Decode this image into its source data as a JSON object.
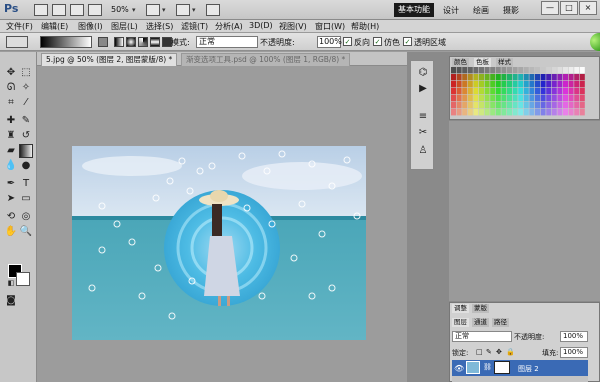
{
  "app": {
    "logo": "Ps"
  },
  "titlebar": {
    "zoom": "50%",
    "workspace_active": "基本功能",
    "workspace_links": [
      "设计",
      "绘画",
      "摄影"
    ],
    "window_buttons": [
      "—",
      "□",
      "×"
    ],
    "chevrons": [
      "▾",
      "▾",
      "▾"
    ]
  },
  "menu": [
    "文件(F)",
    "编辑(E)",
    "图像(I)",
    "图层(L)",
    "选择(S)",
    "滤镜(T)",
    "分析(A)",
    "3D(D)",
    "视图(V)",
    "窗口(W)",
    "帮助(H)"
  ],
  "options": {
    "mode_label": "模式:",
    "mode_value": "正常",
    "opacity_label": "不透明度:",
    "opacity_value": "100%",
    "checkboxes": [
      {
        "label": "反向",
        "checked": true
      },
      {
        "label": "仿色",
        "checked": true
      },
      {
        "label": "透明区域",
        "checked": true
      }
    ]
  },
  "tabs": [
    {
      "label": "5.jpg @ 50% (图层 2, 图层蒙版/8) *",
      "active": true
    },
    {
      "label": "渐变选项工具.psd @ 100% (图层 1, RGB/8) *",
      "active": false
    }
  ],
  "swatches_panel": {
    "tabs": [
      "颜色",
      "色板",
      "样式"
    ]
  },
  "layers_panel": {
    "top_tabs": [
      "调整",
      "蒙版"
    ],
    "tabs": [
      "图层",
      "通道",
      "路径"
    ],
    "blend_mode": "正常",
    "opacity_label": "不透明度:",
    "opacity_value": "100%",
    "lock_label": "锁定:",
    "fill_label": "填充:",
    "fill_value": "100%",
    "layer_name": "图层 2"
  },
  "colors": {
    "accent_blue": "#3a6ab5",
    "canvas_bg": "#9c9c9c",
    "foreground": "#000000",
    "background": "#ffffff"
  }
}
